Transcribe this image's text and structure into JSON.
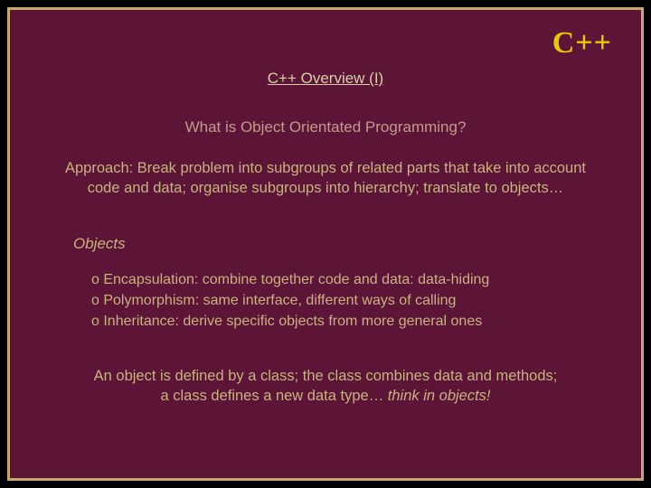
{
  "logo": "C++",
  "title": "C++ Overview (I)",
  "subheading": "What is Object Orientated Programming?",
  "approach": "Approach: Break problem into subgroups of related parts that take into account code and data; organise subgroups into hierarchy; translate to objects…",
  "objects_label": "Objects",
  "bullets": [
    "o Encapsulation: combine together code and data: data-hiding",
    "o Polymorphism: same interface, different ways of calling",
    "o Inheritance: derive specific objects from more general ones"
  ],
  "footer_line1": "An object is defined by a class; the class combines data and methods;",
  "footer_line2_plain": "a class defines a new data type… ",
  "footer_line2_italic": "think in objects!"
}
